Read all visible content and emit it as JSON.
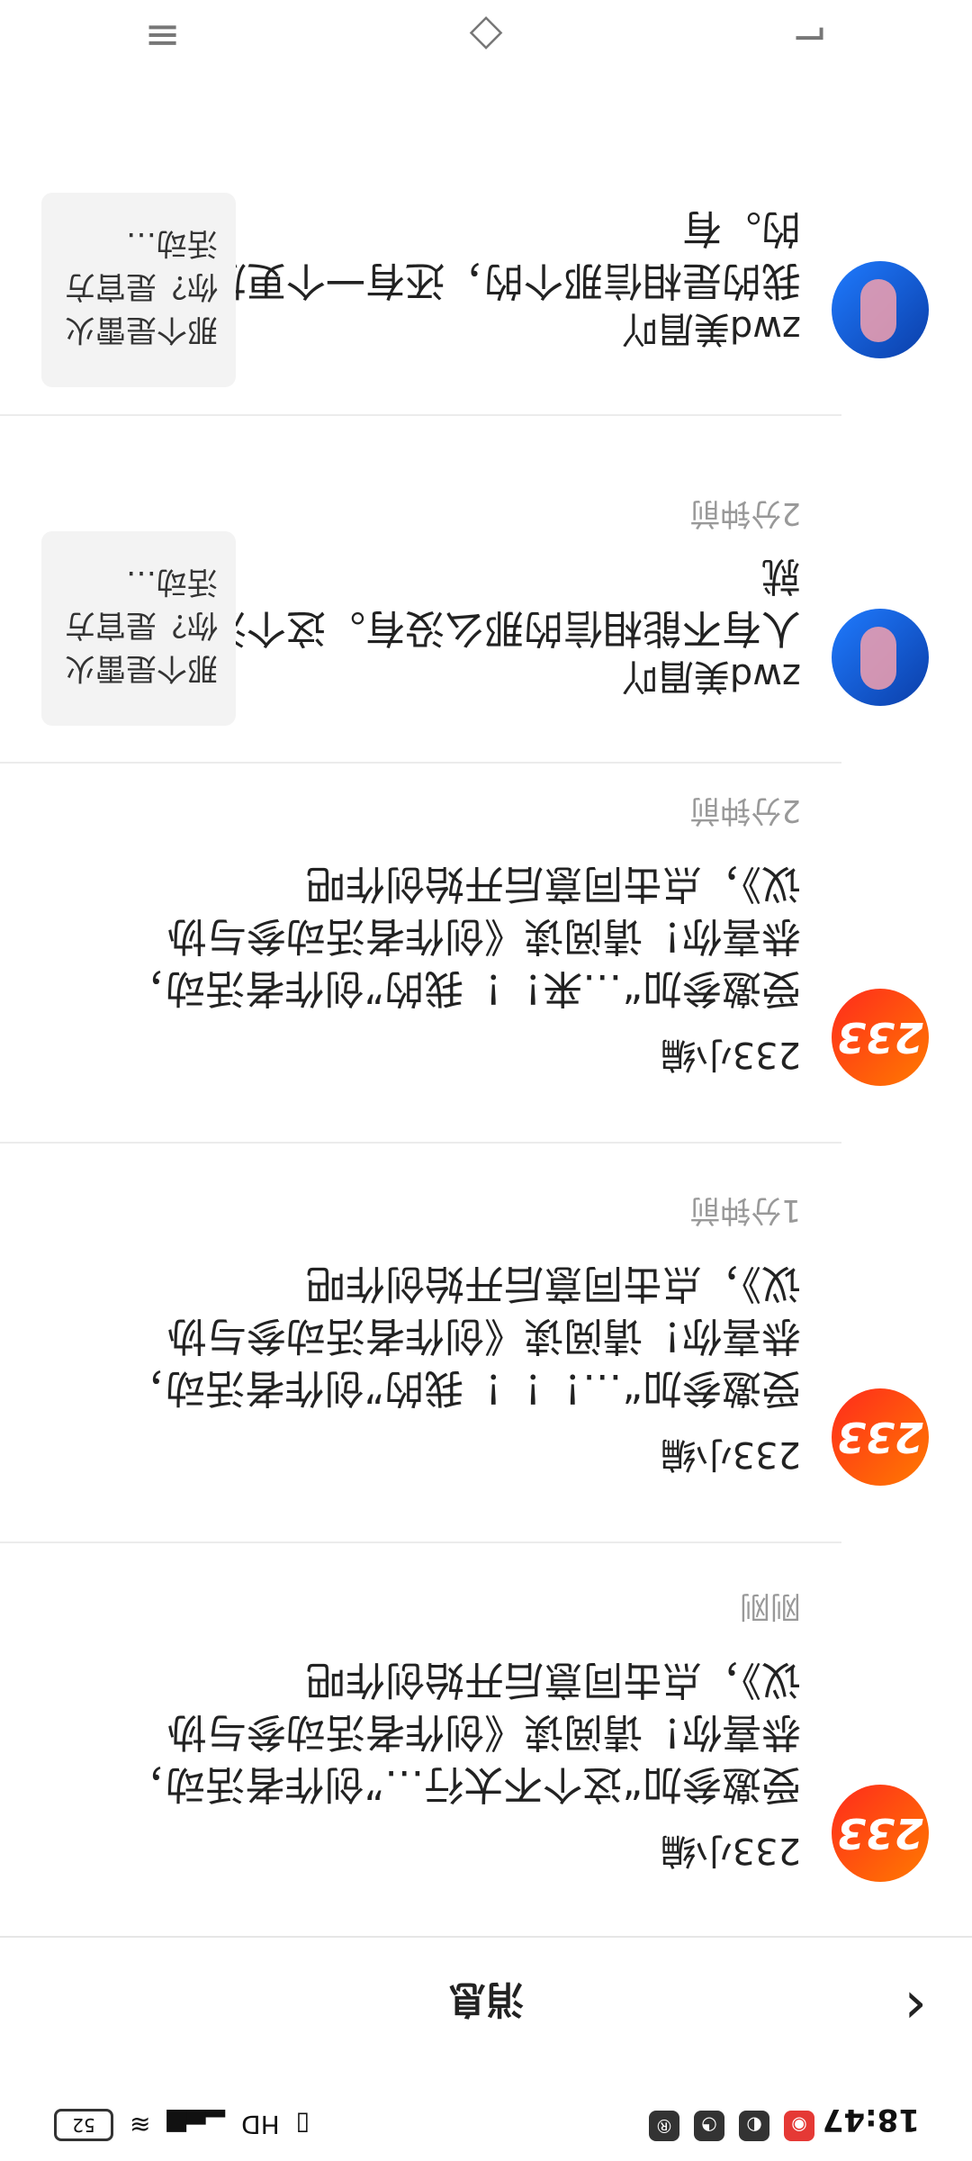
{
  "status_bar": {
    "time": "18:47",
    "left_icons": [
      "app-icon",
      "chat-icon",
      "map-icon",
      "notification-badge-icon"
    ],
    "right_icons": [
      "vibrate-icon",
      "hd-icon",
      "signal-icon",
      "wifi-icon"
    ],
    "battery": "52"
  },
  "header": {
    "back_icon": "chevron-left-icon",
    "title": "消息"
  },
  "messages": [
    {
      "sender": "233小编",
      "text": "受邀参加“这个不太行…”创作者活动，恭喜你！请阅读《创作者活动参与协议》，点击同意后开始创作吧",
      "time": "刚刚"
    },
    {
      "sender": "233小编",
      "text": "受邀参加“…！！！我的”创作者活动，恭喜你！请阅读《创作者活动参与协议》，点击同意后开始创作吧",
      "time": "1分钟前"
    },
    {
      "sender": "233小编",
      "text": "受邀参加“…来！！我的”创作者活动，恭喜你！请阅读《创作者活动参与协议》，点击同意后开始创作吧",
      "time": "2分钟前"
    },
    {
      "sender": "zwd美眉吖",
      "text": "人有不能相信的那么没有。这个没办法就",
      "time": "2分钟前",
      "thumb_text": "那个是雷火你？是官方活动…"
    },
    {
      "sender": "zwd美眉吖",
      "text": "我的是相信那个的，还有一个更加好的。有",
      "thumb_text": "那个是雷火你？是官方活动…"
    }
  ],
  "bottom_nav": {
    "icons": [
      "back-triangle-icon",
      "home-icon",
      "menu-icon"
    ]
  }
}
